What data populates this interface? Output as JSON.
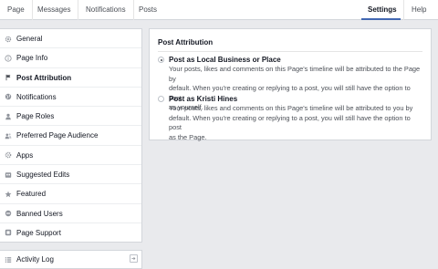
{
  "topnav": {
    "tabs": [
      "Page",
      "Messages",
      "Notifications",
      "Posts"
    ],
    "settings": "Settings",
    "help": "Help"
  },
  "sidebar": {
    "items": [
      {
        "label": "General",
        "icon": "gear-icon"
      },
      {
        "label": "Page Info",
        "icon": "info-icon"
      },
      {
        "label": "Post Attribution",
        "icon": "flag-icon"
      },
      {
        "label": "Notifications",
        "icon": "globe-icon"
      },
      {
        "label": "Page Roles",
        "icon": "person-icon"
      },
      {
        "label": "Preferred Page Audience",
        "icon": "audience-icon"
      },
      {
        "label": "Apps",
        "icon": "apps-icon"
      },
      {
        "label": "Suggested Edits",
        "icon": "edit-icon"
      },
      {
        "label": "Featured",
        "icon": "star-icon"
      },
      {
        "label": "Banned Users",
        "icon": "banned-icon"
      },
      {
        "label": "Page Support",
        "icon": "support-icon"
      }
    ],
    "selected_index": 2,
    "activity_log": "Activity Log"
  },
  "panel": {
    "title": "Post Attribution",
    "options": [
      {
        "label": "Post as Local Business or Place",
        "checked": true,
        "desc_lines": [
          "Your posts, likes and comments on this Page's timeline will be attributed to the Page by",
          "default. When you're creating or replying to a post, you will still have the option to post",
          "as yourself."
        ]
      },
      {
        "label": "Post as Kristi Hines",
        "checked": false,
        "desc_lines": [
          "Your posts, likes and comments on this Page's timeline will be attributed to you by",
          "default. When you're creating or replying to a post, you will still have the option to post",
          "as the Page."
        ]
      }
    ]
  },
  "colors": {
    "background": "#e9eaed",
    "accent": "#4267b2",
    "border": "#d3d6db"
  }
}
